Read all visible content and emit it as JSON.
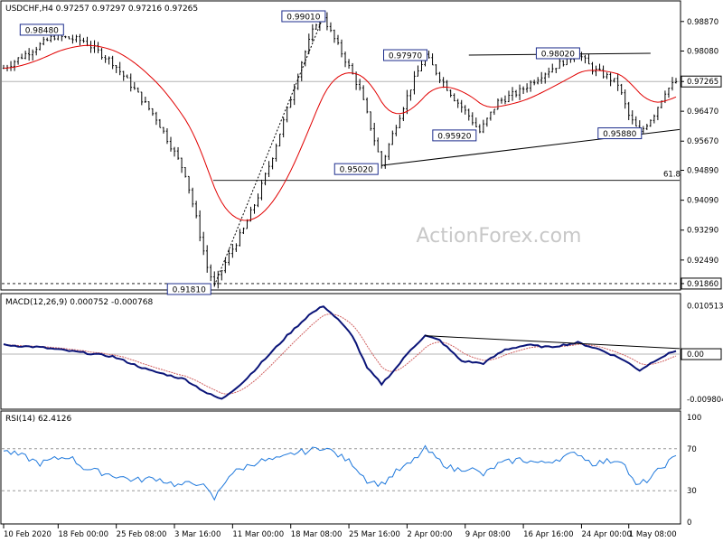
{
  "chart_data": [
    {
      "type": "candlestick",
      "symbol_line": "USDCHF,H4  0.97257 0.97297 0.97216 0.97265",
      "watermark": "ActionForex.com",
      "y_ticks": [
        "0.98870",
        "0.98080",
        "0.97265",
        "0.96470",
        "0.95670",
        "0.94890",
        "0.94090",
        "0.93290",
        "0.92490",
        "0.91860"
      ],
      "current_price": "0.97265",
      "x_labels": [
        "10 Feb 2020",
        "18 Feb 00:00",
        "25 Feb 08:00",
        "3 Mar 16:00",
        "11 Mar 00:00",
        "18 Mar 08:00",
        "25 Mar 16:00",
        "2 Apr 00:00",
        "9 Apr 08:00",
        "16 Apr 16:00",
        "24 Apr 00:00",
        "1 May 08:00"
      ],
      "annotations": [
        {
          "label": "0.98480",
          "value": 0.9848
        },
        {
          "label": "0.99010",
          "value": 0.9901
        },
        {
          "label": "0.97970",
          "value": 0.9797
        },
        {
          "label": "0.98020",
          "value": 0.9802
        },
        {
          "label": "0.95920",
          "value": 0.9592
        },
        {
          "label": "0.95880",
          "value": 0.9588
        },
        {
          "label": "0.95020",
          "value": 0.9502
        },
        {
          "label": "0.91810",
          "value": 0.9181
        }
      ],
      "fib_label": "61.8",
      "fib_level": 0.9462,
      "support_level": 0.9186,
      "price_path": [
        [
          0,
          0.9762
        ],
        [
          6,
          0.98
        ],
        [
          14,
          0.9848
        ],
        [
          22,
          0.9835
        ],
        [
          30,
          0.9778
        ],
        [
          36,
          0.9705
        ],
        [
          42,
          0.9628
        ],
        [
          46,
          0.9555
        ],
        [
          50,
          0.948
        ],
        [
          53,
          0.936
        ],
        [
          56,
          0.923
        ],
        [
          58,
          0.9181
        ],
        [
          62,
          0.9262
        ],
        [
          66,
          0.933
        ],
        [
          70,
          0.942
        ],
        [
          74,
          0.9528
        ],
        [
          78,
          0.965
        ],
        [
          82,
          0.978
        ],
        [
          86,
          0.9885
        ],
        [
          88,
          0.9901
        ],
        [
          90,
          0.9858
        ],
        [
          94,
          0.9785
        ],
        [
          98,
          0.9705
        ],
        [
          101,
          0.9605
        ],
        [
          104,
          0.9502
        ],
        [
          108,
          0.9612
        ],
        [
          112,
          0.971
        ],
        [
          116,
          0.9797
        ],
        [
          120,
          0.9738
        ],
        [
          124,
          0.9682
        ],
        [
          128,
          0.9635
        ],
        [
          131,
          0.9592
        ],
        [
          136,
          0.9672
        ],
        [
          142,
          0.97
        ],
        [
          148,
          0.9745
        ],
        [
          154,
          0.978
        ],
        [
          158,
          0.9802
        ],
        [
          162,
          0.976
        ],
        [
          166,
          0.974
        ],
        [
          169,
          0.972
        ],
        [
          172,
          0.9635
        ],
        [
          175,
          0.9588
        ],
        [
          179,
          0.964
        ],
        [
          182,
          0.97
        ],
        [
          185,
          0.9726
        ]
      ],
      "macd": {
        "label": "MACD(12,26,9) 0.000752 -0.000768",
        "y_ticks": [
          "0.010513",
          "0.00",
          "-0.009804"
        ],
        "path": [
          [
            0,
            0.002
          ],
          [
            10,
            0.0015
          ],
          [
            20,
            0.0005
          ],
          [
            30,
            -0.0005
          ],
          [
            40,
            -0.0035
          ],
          [
            50,
            -0.0055
          ],
          [
            56,
            -0.0085
          ],
          [
            60,
            -0.0098
          ],
          [
            66,
            -0.006
          ],
          [
            72,
            -0.001
          ],
          [
            78,
            0.004
          ],
          [
            84,
            0.0085
          ],
          [
            88,
            0.0105
          ],
          [
            92,
            0.0075
          ],
          [
            96,
            0.004
          ],
          [
            100,
            -0.003
          ],
          [
            104,
            -0.0065
          ],
          [
            108,
            -0.003
          ],
          [
            112,
            0.001
          ],
          [
            116,
            0.004
          ],
          [
            120,
            0.003
          ],
          [
            126,
            -0.0015
          ],
          [
            132,
            -0.002
          ],
          [
            138,
            0.001
          ],
          [
            144,
            0.002
          ],
          [
            150,
            0.0015
          ],
          [
            158,
            0.0025
          ],
          [
            164,
            0.001
          ],
          [
            170,
            -0.001
          ],
          [
            175,
            -0.0035
          ],
          [
            180,
            -0.001
          ],
          [
            185,
            0.0008
          ]
        ]
      },
      "rsi": {
        "label": "RSI(14) 62.4126",
        "y_ticks": [
          "100",
          "70",
          "30",
          "0"
        ],
        "path": [
          [
            0,
            68
          ],
          [
            6,
            62
          ],
          [
            10,
            56
          ],
          [
            14,
            60
          ],
          [
            18,
            63
          ],
          [
            22,
            52
          ],
          [
            26,
            48
          ],
          [
            30,
            45
          ],
          [
            36,
            40
          ],
          [
            42,
            42
          ],
          [
            48,
            35
          ],
          [
            54,
            38
          ],
          [
            58,
            22
          ],
          [
            62,
            45
          ],
          [
            66,
            52
          ],
          [
            70,
            58
          ],
          [
            76,
            60
          ],
          [
            80,
            66
          ],
          [
            84,
            68
          ],
          [
            88,
            72
          ],
          [
            92,
            64
          ],
          [
            96,
            56
          ],
          [
            100,
            40
          ],
          [
            104,
            36
          ],
          [
            108,
            48
          ],
          [
            112,
            56
          ],
          [
            116,
            70
          ],
          [
            120,
            58
          ],
          [
            124,
            50
          ],
          [
            128,
            52
          ],
          [
            132,
            45
          ],
          [
            136,
            55
          ],
          [
            142,
            60
          ],
          [
            148,
            56
          ],
          [
            154,
            62
          ],
          [
            158,
            66
          ],
          [
            162,
            56
          ],
          [
            166,
            58
          ],
          [
            170,
            60
          ],
          [
            174,
            34
          ],
          [
            178,
            42
          ],
          [
            182,
            55
          ],
          [
            185,
            62
          ]
        ]
      }
    }
  ]
}
